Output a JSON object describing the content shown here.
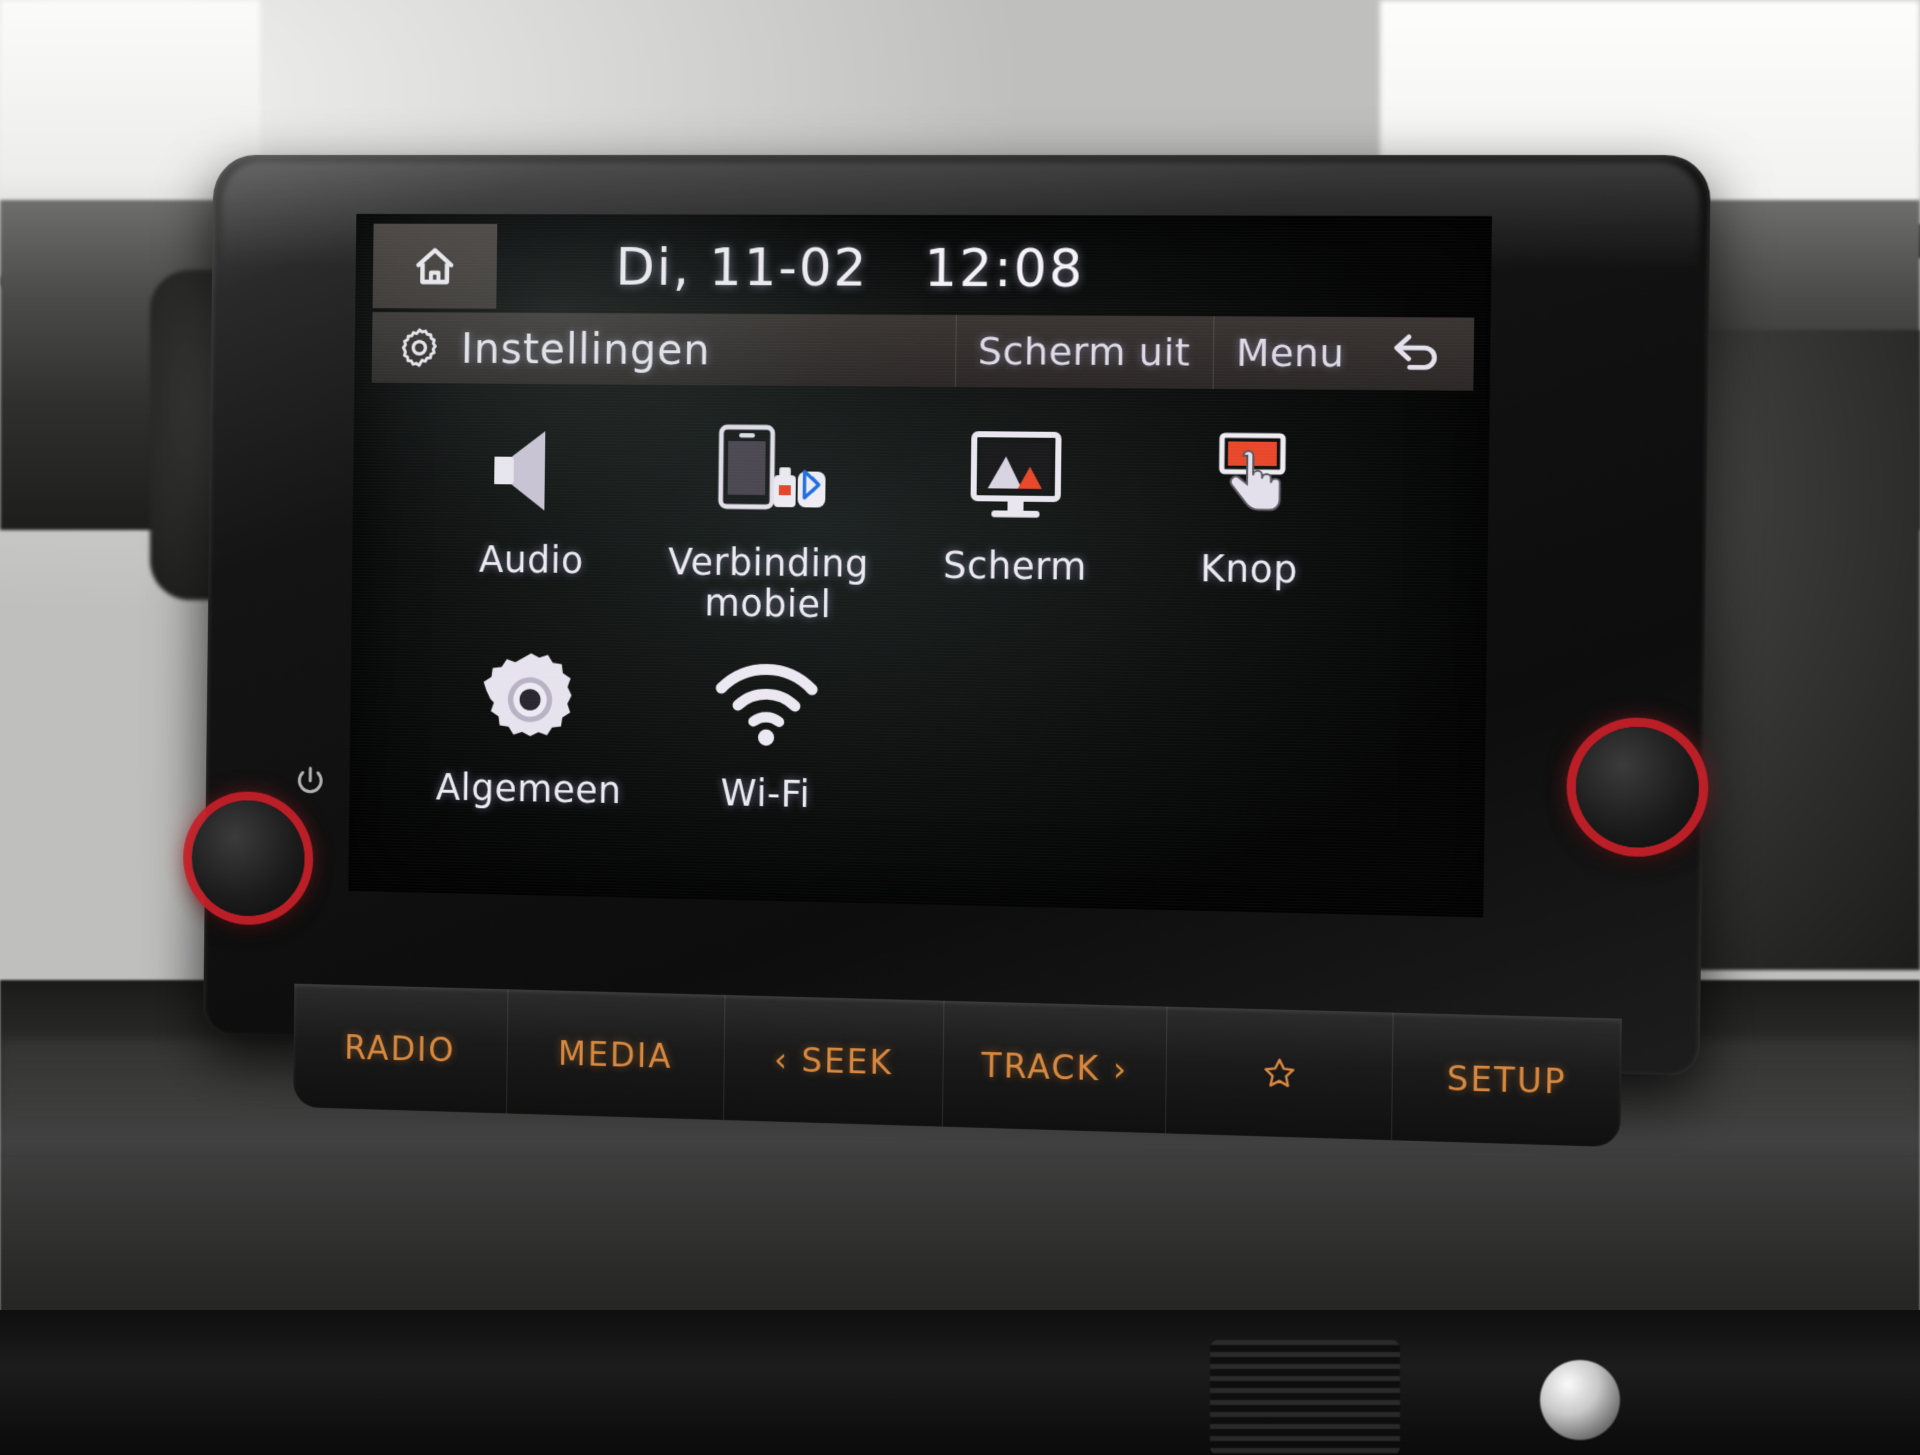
{
  "device": {
    "type": "car-infotainment-head-unit",
    "accent_color": "#d9893f",
    "screen_text_color": "#ece9f2",
    "knob_ring_color": "#c62028"
  },
  "status_bar": {
    "home_icon": "home-icon",
    "date": "Di, 11-02",
    "time": "12:08"
  },
  "title_bar": {
    "icon": "gear-icon",
    "title": "Instellingen",
    "screen_off_label": "Scherm uit",
    "menu_label": "Menu",
    "back_icon": "back-arrow-icon"
  },
  "menu": {
    "rows": [
      [
        {
          "label": "Audio",
          "icon": "speaker-icon"
        },
        {
          "label": "Verbinding\nmobiel",
          "line1": "Verbinding",
          "line2": "mobiel",
          "icon": "phone-bluetooth-usb-icon"
        },
        {
          "label": "Scherm",
          "icon": "display-picture-icon"
        },
        {
          "label": "Knop",
          "icon": "hand-touch-button-icon"
        }
      ],
      [
        {
          "label": "Algemeen",
          "icon": "gear-solid-icon"
        },
        {
          "label": "Wi-Fi",
          "icon": "wifi-icon"
        }
      ]
    ]
  },
  "hardware_buttons": [
    {
      "label": "RADIO",
      "icon": ""
    },
    {
      "label": "MEDIA",
      "icon": ""
    },
    {
      "label": "‹ SEEK",
      "icon": "seek-left-icon"
    },
    {
      "label": "TRACK ›",
      "icon": "track-right-icon"
    },
    {
      "label": "",
      "icon": "star-icon"
    },
    {
      "label": "SETUP",
      "icon": ""
    }
  ],
  "knobs": {
    "left_icon": "power-icon",
    "left_name": "power-volume-knob",
    "right_name": "tune-knob"
  }
}
